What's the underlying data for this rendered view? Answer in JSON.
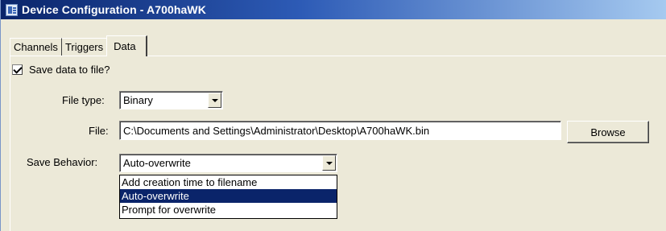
{
  "window": {
    "title": "Device Configuration - A700haWK",
    "icon": "device-config-icon"
  },
  "tabs": [
    {
      "label": "Channels",
      "active": false
    },
    {
      "label": "Triggers",
      "active": false
    },
    {
      "label": "Data",
      "active": true
    }
  ],
  "save_to_file": {
    "label": "Save data to file?",
    "checked": true
  },
  "file_type": {
    "label": "File type:",
    "value": "Binary"
  },
  "file": {
    "label": "File:",
    "value": "C:\\Documents and Settings\\Administrator\\Desktop\\A700haWK.bin",
    "browse_label": "Browse"
  },
  "save_behavior": {
    "label": "Save Behavior:",
    "value": "Auto-overwrite",
    "options": [
      "Add creation time to filename",
      "Auto-overwrite",
      "Prompt for overwrite"
    ],
    "selected_index": 1
  },
  "colors": {
    "titlebar_start": "#0a246a",
    "titlebar_end": "#a6caf0",
    "selection": "#0a246a",
    "dialog_bg": "#ece9d8"
  }
}
